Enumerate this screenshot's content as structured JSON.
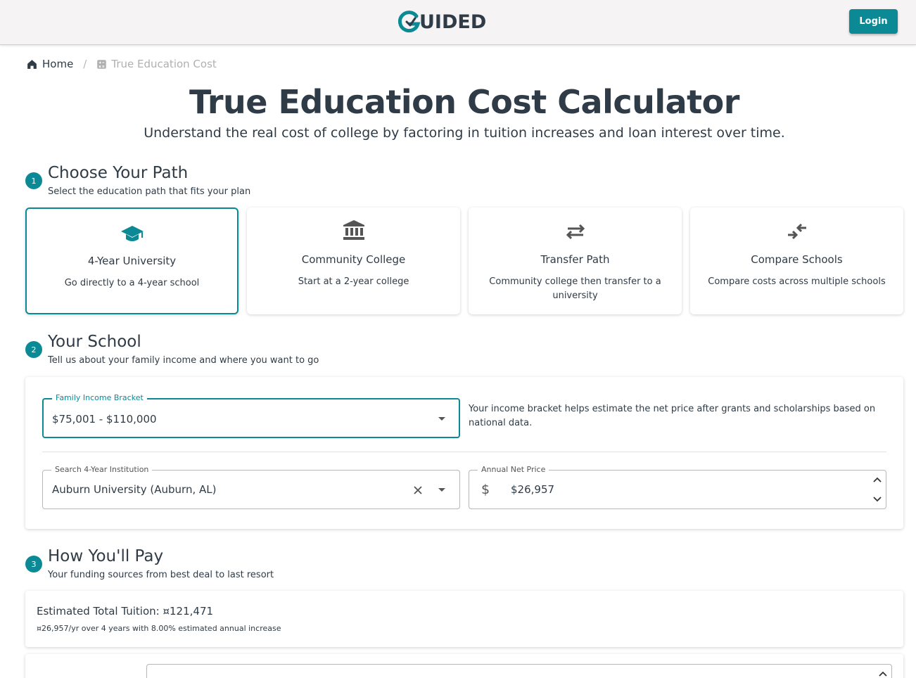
{
  "header": {
    "logo_text": "UIDED",
    "login_label": "Login"
  },
  "breadcrumb": {
    "home_label": "Home",
    "separator": "/",
    "current_label": "True Education Cost"
  },
  "page": {
    "title": "True Education Cost Calculator",
    "subtitle": "Understand the real cost of college by factoring in tuition increases and loan interest over time."
  },
  "sections": [
    {
      "number": "1",
      "title": "Choose Your Path",
      "description": "Select the education path that fits your plan"
    },
    {
      "number": "2",
      "title": "Your School",
      "description": "Tell us about your family income and where you want to go"
    },
    {
      "number": "3",
      "title": "How You'll Pay",
      "description": "Your funding sources from best deal to last resort"
    }
  ],
  "paths": [
    {
      "icon": "graduation-cap-icon",
      "name": "4-Year University",
      "description": "Go directly to a 4-year school",
      "selected": true
    },
    {
      "icon": "institution-icon",
      "name": "Community College",
      "description": "Start at a 2-year college",
      "selected": false
    },
    {
      "icon": "transfer-arrows-icon",
      "name": "Transfer Path",
      "description": "Community college then transfer to a university",
      "selected": false
    },
    {
      "icon": "compare-arrows-icon",
      "name": "Compare Schools",
      "description": "Compare costs across multiple schools",
      "selected": false
    }
  ],
  "school": {
    "income_label": "Family Income Bracket",
    "income_value": "$75,001 - $110,000",
    "income_help": "Your income bracket helps estimate the net price after grants and scholarships based on national data.",
    "institution_label": "Search 4-Year Institution",
    "institution_value": "Auburn University (Auburn, AL)",
    "net_price_label": "Annual Net Price",
    "net_price_prefix": "$",
    "net_price_value": "$26,957"
  },
  "payment": {
    "tuition_title": "Estimated Total Tuition: ¤121,471",
    "tuition_detail": "¤26,957/yr over 4 years with 8.00% estimated annual increase"
  },
  "colors": {
    "accent": "#0b8a95",
    "text": "#2f3b46",
    "header_bg": "#f5f3f3"
  }
}
